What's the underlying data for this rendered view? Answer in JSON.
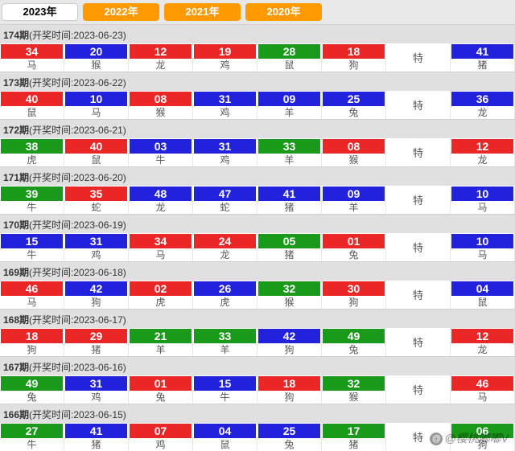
{
  "tabs": [
    {
      "label": "2023年",
      "active": true
    },
    {
      "label": "2022年",
      "active": false
    },
    {
      "label": "2021年",
      "active": false
    },
    {
      "label": "2020年",
      "active": false
    }
  ],
  "header_labels": {
    "period_suffix": "期",
    "open_time_prefix": "(开奖时间:",
    "open_time_suffix": ")"
  },
  "special_label": "特",
  "periods": [
    {
      "period": "174",
      "open_time": "2023-06-23",
      "numbers": [
        {
          "n": "34",
          "c": "red",
          "z": "马"
        },
        {
          "n": "20",
          "c": "blue",
          "z": "猴"
        },
        {
          "n": "12",
          "c": "red",
          "z": "龙"
        },
        {
          "n": "19",
          "c": "red",
          "z": "鸡"
        },
        {
          "n": "28",
          "c": "green",
          "z": "鼠"
        },
        {
          "n": "18",
          "c": "red",
          "z": "狗"
        }
      ],
      "special": {
        "n": "41",
        "c": "blue",
        "z": "猪"
      }
    },
    {
      "period": "173",
      "open_time": "2023-06-22",
      "numbers": [
        {
          "n": "40",
          "c": "red",
          "z": "鼠"
        },
        {
          "n": "10",
          "c": "blue",
          "z": "马"
        },
        {
          "n": "08",
          "c": "red",
          "z": "猴"
        },
        {
          "n": "31",
          "c": "blue",
          "z": "鸡"
        },
        {
          "n": "09",
          "c": "blue",
          "z": "羊"
        },
        {
          "n": "25",
          "c": "blue",
          "z": "兔"
        }
      ],
      "special": {
        "n": "36",
        "c": "blue",
        "z": "龙"
      }
    },
    {
      "period": "172",
      "open_time": "2023-06-21",
      "numbers": [
        {
          "n": "38",
          "c": "green",
          "z": "虎"
        },
        {
          "n": "40",
          "c": "red",
          "z": "鼠"
        },
        {
          "n": "03",
          "c": "blue",
          "z": "牛"
        },
        {
          "n": "31",
          "c": "blue",
          "z": "鸡"
        },
        {
          "n": "33",
          "c": "green",
          "z": "羊"
        },
        {
          "n": "08",
          "c": "red",
          "z": "猴"
        }
      ],
      "special": {
        "n": "12",
        "c": "red",
        "z": "龙"
      }
    },
    {
      "period": "171",
      "open_time": "2023-06-20",
      "numbers": [
        {
          "n": "39",
          "c": "green",
          "z": "牛"
        },
        {
          "n": "35",
          "c": "red",
          "z": "蛇"
        },
        {
          "n": "48",
          "c": "blue",
          "z": "龙"
        },
        {
          "n": "47",
          "c": "blue",
          "z": "蛇"
        },
        {
          "n": "41",
          "c": "blue",
          "z": "猪"
        },
        {
          "n": "09",
          "c": "blue",
          "z": "羊"
        }
      ],
      "special": {
        "n": "10",
        "c": "blue",
        "z": "马"
      }
    },
    {
      "period": "170",
      "open_time": "2023-06-19",
      "numbers": [
        {
          "n": "15",
          "c": "blue",
          "z": "牛"
        },
        {
          "n": "31",
          "c": "blue",
          "z": "鸡"
        },
        {
          "n": "34",
          "c": "red",
          "z": "马"
        },
        {
          "n": "24",
          "c": "red",
          "z": "龙"
        },
        {
          "n": "05",
          "c": "green",
          "z": "猪"
        },
        {
          "n": "01",
          "c": "red",
          "z": "兔"
        }
      ],
      "special": {
        "n": "10",
        "c": "blue",
        "z": "马"
      }
    },
    {
      "period": "169",
      "open_time": "2023-06-18",
      "numbers": [
        {
          "n": "46",
          "c": "red",
          "z": "马"
        },
        {
          "n": "42",
          "c": "blue",
          "z": "狗"
        },
        {
          "n": "02",
          "c": "red",
          "z": "虎"
        },
        {
          "n": "26",
          "c": "blue",
          "z": "虎"
        },
        {
          "n": "32",
          "c": "green",
          "z": "猴"
        },
        {
          "n": "30",
          "c": "red",
          "z": "狗"
        }
      ],
      "special": {
        "n": "04",
        "c": "blue",
        "z": "鼠"
      }
    },
    {
      "period": "168",
      "open_time": "2023-06-17",
      "numbers": [
        {
          "n": "18",
          "c": "red",
          "z": "狗"
        },
        {
          "n": "29",
          "c": "red",
          "z": "猪"
        },
        {
          "n": "21",
          "c": "green",
          "z": "羊"
        },
        {
          "n": "33",
          "c": "green",
          "z": "羊"
        },
        {
          "n": "42",
          "c": "blue",
          "z": "狗"
        },
        {
          "n": "49",
          "c": "green",
          "z": "兔"
        }
      ],
      "special": {
        "n": "12",
        "c": "red",
        "z": "龙"
      }
    },
    {
      "period": "167",
      "open_time": "2023-06-16",
      "numbers": [
        {
          "n": "49",
          "c": "green",
          "z": "兔"
        },
        {
          "n": "31",
          "c": "blue",
          "z": "鸡"
        },
        {
          "n": "01",
          "c": "red",
          "z": "兔"
        },
        {
          "n": "15",
          "c": "blue",
          "z": "牛"
        },
        {
          "n": "18",
          "c": "red",
          "z": "狗"
        },
        {
          "n": "32",
          "c": "green",
          "z": "猴"
        }
      ],
      "special": {
        "n": "46",
        "c": "red",
        "z": "马"
      }
    },
    {
      "period": "166",
      "open_time": "2023-06-15",
      "numbers": [
        {
          "n": "27",
          "c": "green",
          "z": "牛"
        },
        {
          "n": "41",
          "c": "blue",
          "z": "猪"
        },
        {
          "n": "07",
          "c": "red",
          "z": "鸡"
        },
        {
          "n": "04",
          "c": "blue",
          "z": "鼠"
        },
        {
          "n": "25",
          "c": "blue",
          "z": "兔"
        },
        {
          "n": "17",
          "c": "green",
          "z": "猪"
        }
      ],
      "special": {
        "n": "06",
        "c": "green",
        "z": "狗"
      }
    }
  ],
  "watermark": "@樱桃嘟嘟V"
}
